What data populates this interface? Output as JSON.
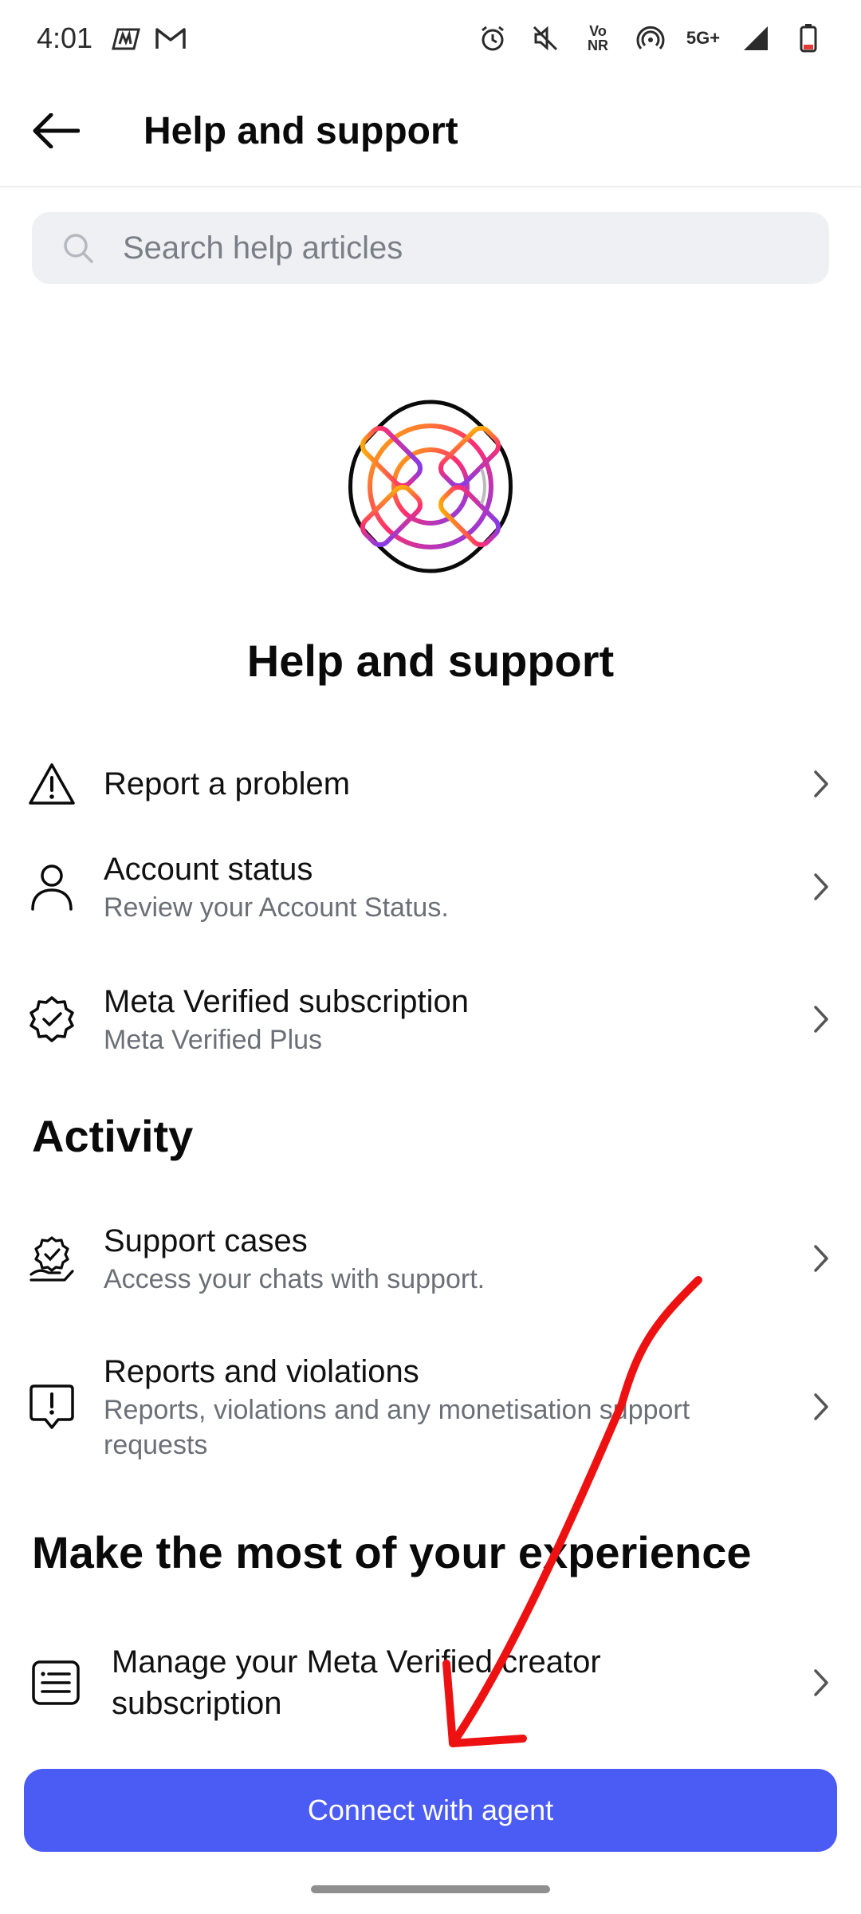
{
  "status_bar": {
    "time": "4:01",
    "network": "5G+",
    "volte": "Vo\nNR"
  },
  "app_bar": {
    "title": "Help and support"
  },
  "search": {
    "placeholder": "Search help articles"
  },
  "hero": {
    "title": "Help and support"
  },
  "top_items": [
    {
      "title": "Report a problem",
      "subtitle": "",
      "icon": "warning-icon"
    },
    {
      "title": "Account status",
      "subtitle": "Review your Account Status.",
      "icon": "person-icon"
    },
    {
      "title": "Meta Verified subscription",
      "subtitle": "Meta Verified Plus",
      "icon": "verified-badge-icon"
    }
  ],
  "activity": {
    "heading": "Activity",
    "items": [
      {
        "title": "Support cases",
        "subtitle": "Access your chats with support.",
        "icon": "support-hand-icon"
      },
      {
        "title": "Reports and violations",
        "subtitle": "Reports, violations and any monetisation support requests",
        "icon": "alert-bubble-icon"
      }
    ]
  },
  "experience": {
    "heading": "Make the most of your experience",
    "items": [
      {
        "title": "Manage your Meta Verified creator subscription",
        "icon": "document-list-icon"
      }
    ]
  },
  "cta": {
    "label": "Connect with agent"
  },
  "colors": {
    "accent": "#4b5cf5",
    "annotation": "#ee1111"
  }
}
